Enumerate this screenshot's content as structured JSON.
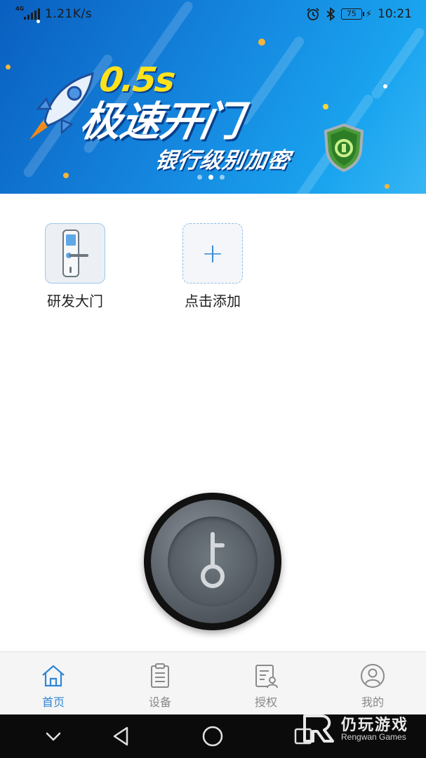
{
  "status_bar": {
    "network_type": "4G",
    "net_speed": "1.21K/s",
    "battery_level": "75",
    "time": "10:21",
    "icons": [
      "signal-icon",
      "alarm-icon",
      "bluetooth-icon",
      "battery-icon",
      "charging-icon"
    ]
  },
  "banner": {
    "brand": "0.5s",
    "title": "极速开门",
    "subtitle": "银行级别加密",
    "page_count": 3,
    "active_page": 2
  },
  "devices": {
    "items": [
      {
        "label": "研发大门",
        "icon": "door-lock-icon"
      }
    ],
    "add_label": "点击添加",
    "add_icon": "plus-icon"
  },
  "unlock_button": {
    "icon": "key-icon"
  },
  "tabbar": {
    "active_color": "#2f86d6",
    "inactive_color": "#888888",
    "tabs": [
      {
        "label": "首页",
        "icon": "home-icon",
        "active": true
      },
      {
        "label": "设备",
        "icon": "clipboard-icon",
        "active": false
      },
      {
        "label": "授权",
        "icon": "authorization-icon",
        "active": false
      },
      {
        "label": "我的",
        "icon": "user-icon",
        "active": false
      }
    ]
  },
  "navbar": {
    "buttons": [
      "collapse-icon",
      "back-icon",
      "home-circle-icon",
      "recents-icon"
    ]
  },
  "watermark": {
    "text": "仍玩游戏",
    "sub": "Rengwan Games"
  }
}
